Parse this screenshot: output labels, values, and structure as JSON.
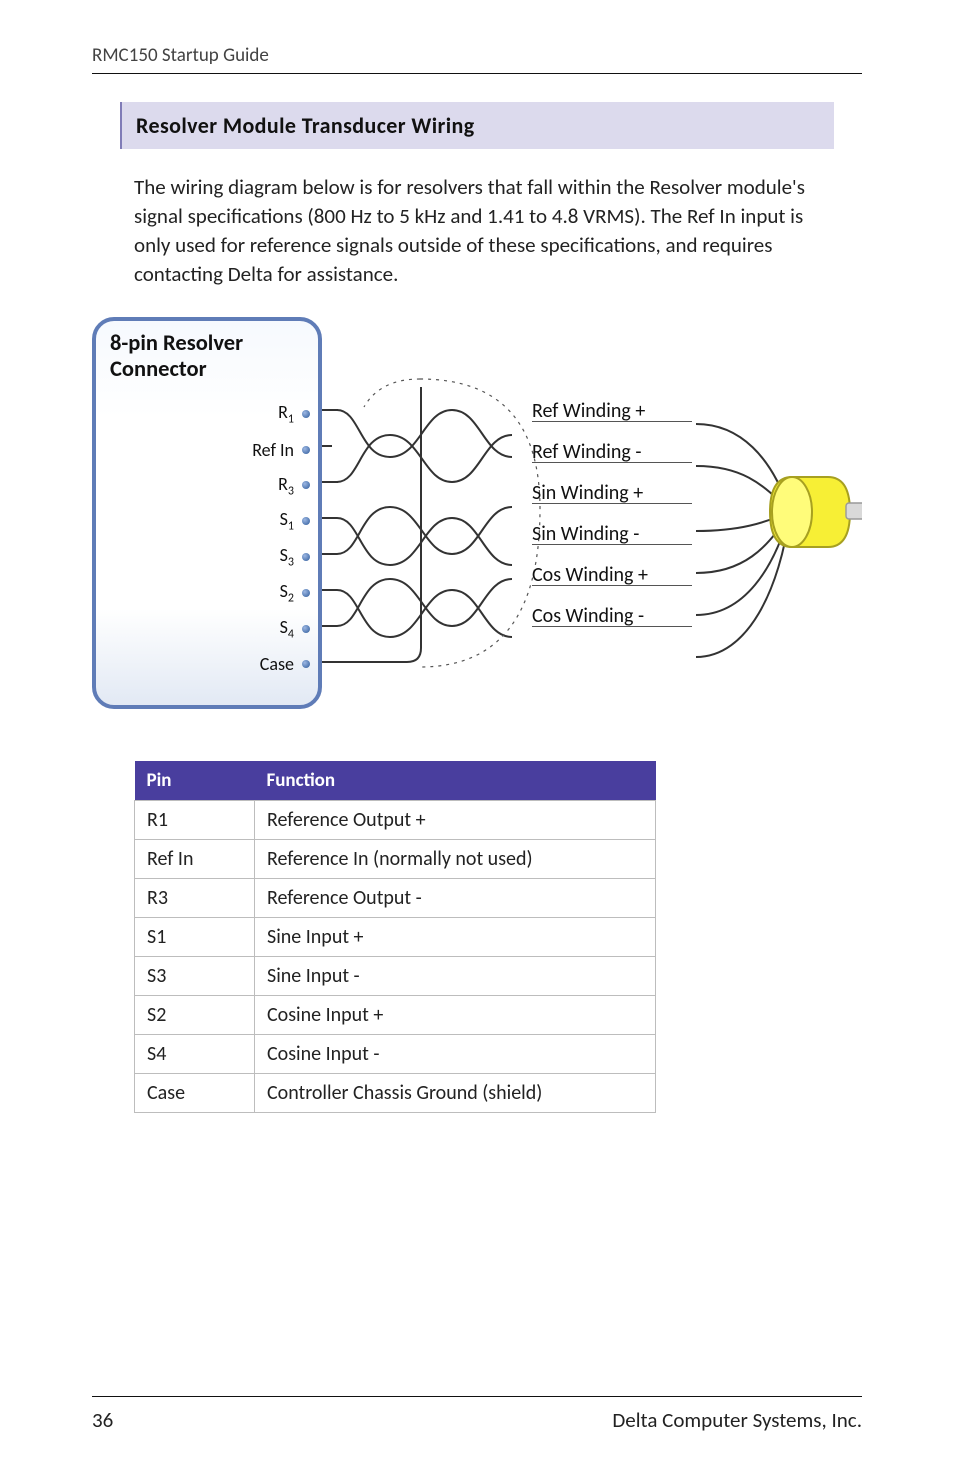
{
  "running_head": "RMC150 Startup Guide",
  "section_heading": "Resolver Module Transducer Wiring",
  "body_paragraph": "The wiring diagram below is for resolvers that fall within the Resolver module's signal specifications (800 Hz to 5 kHz and 1.41 to 4.8 VRMS). The Ref In input is only used for reference signals outside of these specifications, and requires contacting Delta for assistance.",
  "connector": {
    "title_line1": "8-pin Resolver",
    "title_line2": "Connector",
    "pins": [
      {
        "label_html": "R<span class='sub'>1</span>",
        "name": "R1"
      },
      {
        "label_html": "Ref In",
        "name": "RefIn"
      },
      {
        "label_html": "R<span class='sub'>3</span>",
        "name": "R3"
      },
      {
        "label_html": "S<span class='sub'>1</span>",
        "name": "S1"
      },
      {
        "label_html": "S<span class='sub'>3</span>",
        "name": "S3"
      },
      {
        "label_html": "S<span class='sub'>2</span>",
        "name": "S2"
      },
      {
        "label_html": "S<span class='sub'>4</span>",
        "name": "S4"
      },
      {
        "label_html": "Case",
        "name": "Case"
      }
    ]
  },
  "wire_labels": [
    "Ref Winding +",
    "Ref Winding -",
    "Sin Winding +",
    "Sin Winding -",
    "Cos Winding +",
    "Cos Winding -"
  ],
  "table": {
    "head": {
      "pin": "Pin",
      "fn": "Function"
    },
    "rows": [
      {
        "pin": "R1",
        "fn": "Reference Output +"
      },
      {
        "pin": "Ref In",
        "fn": "Reference In (normally not used)"
      },
      {
        "pin": "R3",
        "fn": "Reference Output -"
      },
      {
        "pin": "S1",
        "fn": "Sine Input +"
      },
      {
        "pin": "S3",
        "fn": "Sine Input -"
      },
      {
        "pin": "S2",
        "fn": "Cosine Input +"
      },
      {
        "pin": "S4",
        "fn": "Cosine Input -"
      },
      {
        "pin": "Case",
        "fn": "Controller Chassis Ground (shield)"
      }
    ]
  },
  "footer": {
    "page": "36",
    "company": "Delta Computer Systems, Inc."
  }
}
